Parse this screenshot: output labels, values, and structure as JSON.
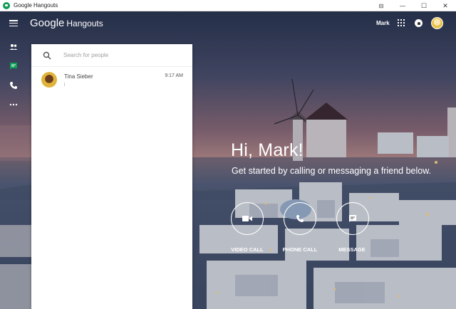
{
  "window": {
    "title": "Google Hangouts",
    "controls": {
      "pin": "⊟",
      "minimize": "—",
      "maximize": "☐",
      "close": "✕"
    }
  },
  "header": {
    "brand_google": "Google",
    "brand_product": "Hangouts",
    "user_name": "Mark"
  },
  "rail": {
    "icons": [
      "people-icon",
      "chat-icon",
      "phone-icon",
      "more-icon"
    ],
    "active": "chat-icon",
    "active_color": "#0f9d58"
  },
  "search": {
    "placeholder": "Search for people",
    "value": ""
  },
  "conversations": [
    {
      "name": "Tina Sieber",
      "time": "9:17 AM"
    }
  ],
  "welcome": {
    "greeting": "Hi, Mark!",
    "subtitle": "Get started by calling or messaging a friend below."
  },
  "actions": [
    {
      "label": "VIDEO CALL",
      "icon": "video-icon"
    },
    {
      "label": "PHONE CALL",
      "icon": "phone-icon"
    },
    {
      "label": "MESSAGE",
      "icon": "message-icon"
    }
  ]
}
